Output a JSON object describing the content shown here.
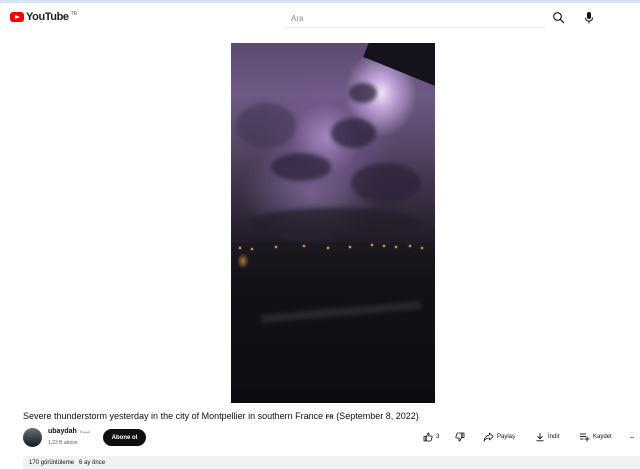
{
  "header": {
    "logo_text": "YouTube",
    "country_code": "TR",
    "search_placeholder": "Ara"
  },
  "video": {
    "title": "Severe thunderstorm yesterday in the city of Montpellier in southern France",
    "title_flag": "FR",
    "title_date": "(September 8, 2022)"
  },
  "channel": {
    "name": "ubaydah",
    "alt_name": "عبيدة",
    "subscribers": "1,23 B abone",
    "subscribe_label": "Abone ol"
  },
  "actions": {
    "like_count": "3",
    "share_label": "Paylaş",
    "download_label": "İndir",
    "save_label": "Kaydet",
    "more_label": "···"
  },
  "description": {
    "views": "170 görüntüleme",
    "date": "6 ay önce"
  },
  "colors": {
    "brand_red": "#ff0000",
    "subscribe_bg": "#0f0f0f",
    "description_bg": "#f2f2f2"
  },
  "icons": [
    "youtube-play-icon",
    "search-icon",
    "mic-icon",
    "thumbs-up-icon",
    "thumbs-down-icon",
    "share-icon",
    "download-icon",
    "save-playlist-icon",
    "more-icon"
  ]
}
